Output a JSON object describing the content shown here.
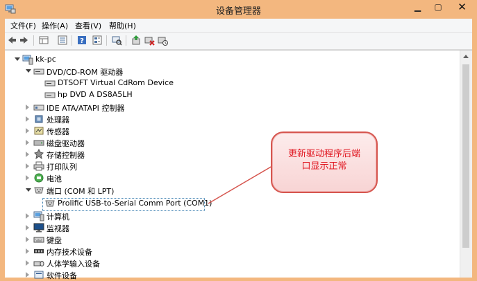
{
  "window": {
    "title": "设备管理器"
  },
  "menubar": {
    "items": [
      "文件(F)",
      "操作(A)",
      "查看(V)",
      "帮助(H)"
    ]
  },
  "toolbar": {
    "icons": [
      "back-icon",
      "forward-icon",
      "properties-grid-icon",
      "details-icon",
      "help-icon",
      "devices-by-type-icon",
      "scan-hardware-icon",
      "update-driver-icon",
      "disable-device-icon",
      "uninstall-device-icon"
    ]
  },
  "tree": {
    "root": "kk-pc",
    "dvd": {
      "label": "DVD/CD-ROM 驱动器",
      "children": [
        "DTSOFT Virtual CdRom Device",
        "hp DVD A  DS8A5LH"
      ]
    },
    "categories": [
      "IDE ATA/ATAPI 控制器",
      "处理器",
      "传感器",
      "磁盘驱动器",
      "存储控制器",
      "打印队列",
      "电池"
    ],
    "ports": {
      "label": "端口 (COM 和 LPT)",
      "child": "Prolific USB-to-Serial Comm Port (COM1)"
    },
    "categories2": [
      "计算机",
      "监视器",
      "键盘",
      "内存技术设备",
      "人体学输入设备",
      "软件设备"
    ]
  },
  "callout": {
    "text": "更新驱动程序后端\n口显示正常",
    "color": "#e0151f"
  }
}
